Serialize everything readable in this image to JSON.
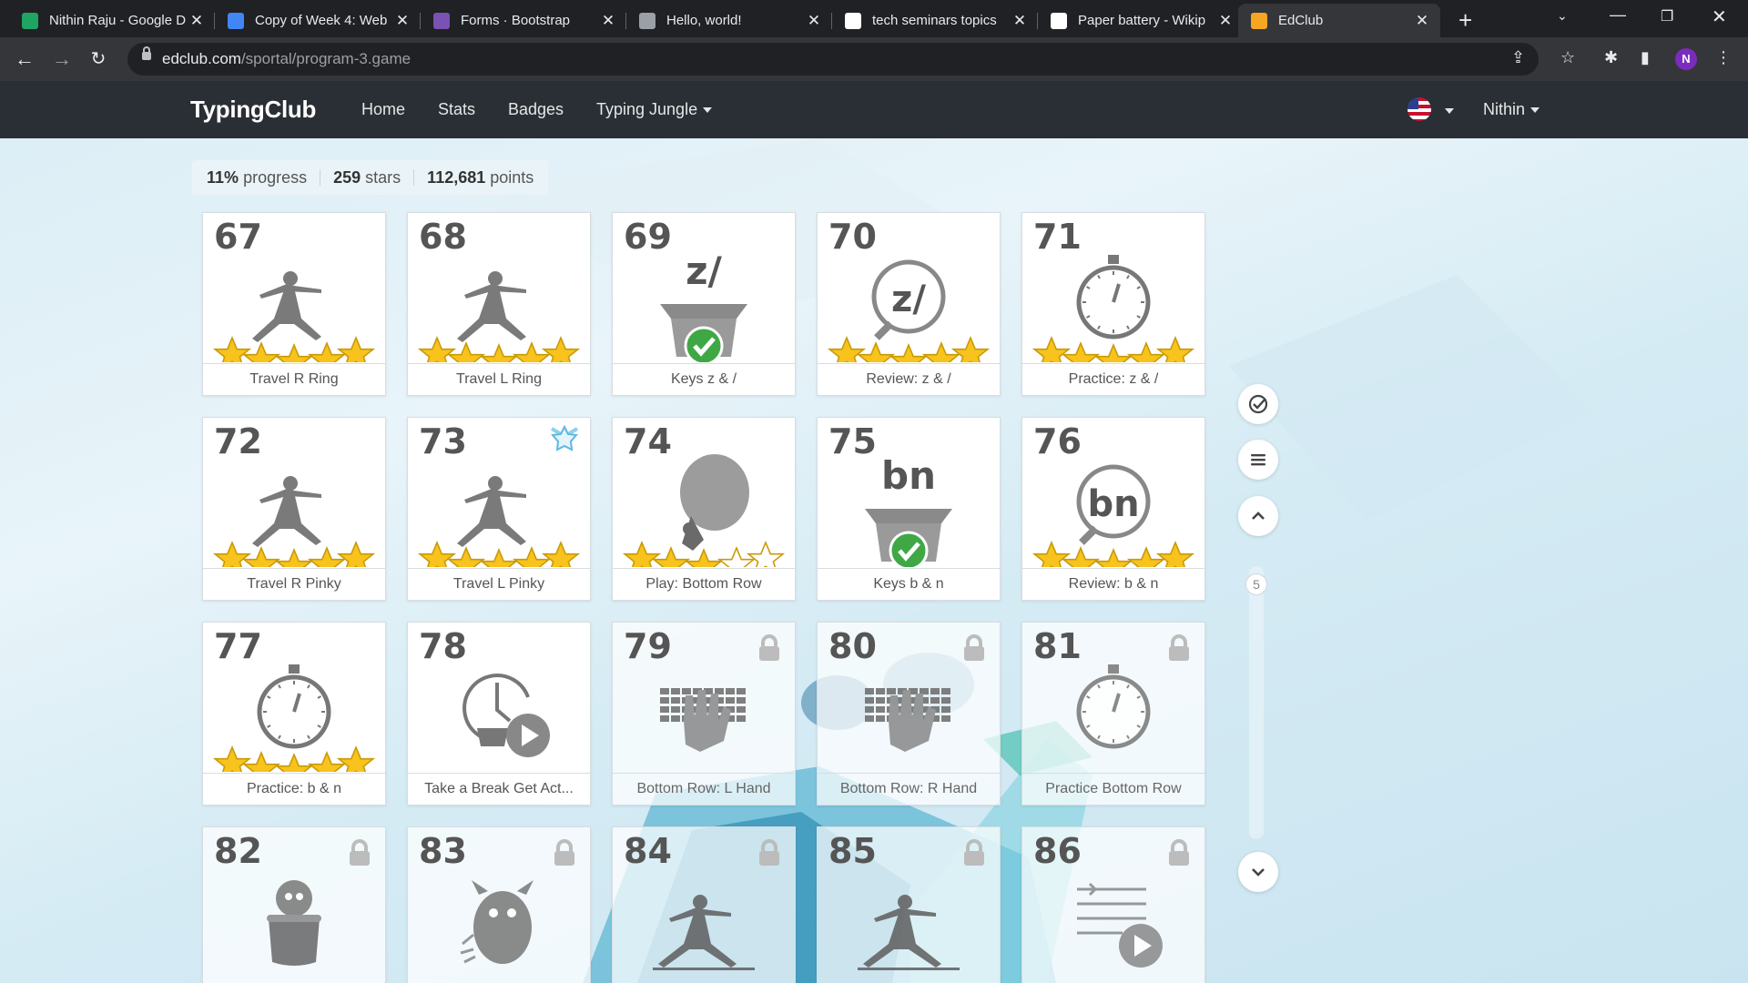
{
  "browser": {
    "tabs": [
      {
        "title": "Nithin Raju - Google D",
        "icon": "google-drive-icon",
        "color": "#1fa463"
      },
      {
        "title": "Copy of Week 4: Web",
        "icon": "google-docs-icon",
        "color": "#4285f4"
      },
      {
        "title": "Forms · Bootstrap",
        "icon": "bootstrap-icon",
        "color": "#7952b3"
      },
      {
        "title": "Hello, world!",
        "icon": "globe-icon",
        "color": "#9aa0a6"
      },
      {
        "title": "tech seminars topics",
        "icon": "google-icon",
        "color": "#ffffff"
      },
      {
        "title": "Paper battery - Wikip",
        "icon": "wikipedia-icon",
        "color": "#ffffff"
      },
      {
        "title": "EdClub",
        "icon": "edclub-icon",
        "color": "#f5a623"
      }
    ],
    "url_host": "edclub.com",
    "url_path": "/sportal/program-3.game",
    "profile_initial": "N"
  },
  "site": {
    "brand": "TypingClub",
    "nav": [
      "Home",
      "Stats",
      "Badges",
      "Typing Jungle"
    ],
    "user": "Nithin"
  },
  "stats": {
    "progress_value": "11%",
    "progress_label": "progress",
    "stars_value": "259",
    "stars_label": "stars",
    "points_value": "112,681",
    "points_label": "points"
  },
  "lessons": [
    {
      "num": "67",
      "label": "Travel R Ring",
      "art": "yoga",
      "stars": 5,
      "locked": false
    },
    {
      "num": "68",
      "label": "Travel L Ring",
      "art": "yoga",
      "stars": 5,
      "locked": false
    },
    {
      "num": "69",
      "label": "Keys z & /",
      "art": "keys",
      "keys": "z/",
      "done": true,
      "locked": false
    },
    {
      "num": "70",
      "label": "Review: z & /",
      "art": "review",
      "keys": "z/",
      "stars": 5,
      "locked": false
    },
    {
      "num": "71",
      "label": "Practice: z & /",
      "art": "stopwatch",
      "stars": 5,
      "locked": false
    },
    {
      "num": "72",
      "label": "Travel R Pinky",
      "art": "yoga",
      "stars": 5,
      "locked": false
    },
    {
      "num": "73",
      "label": "Travel L Pinky",
      "art": "yoga",
      "stars": 5,
      "locked": false,
      "badge": true
    },
    {
      "num": "74",
      "label": "Play: Bottom Row",
      "art": "balloon",
      "stars": 3,
      "locked": false
    },
    {
      "num": "75",
      "label": "Keys b & n",
      "art": "keys",
      "keys": "bn",
      "done": true,
      "locked": false
    },
    {
      "num": "76",
      "label": "Review: b & n",
      "art": "review",
      "keys": "bn",
      "stars": 5,
      "locked": false
    },
    {
      "num": "77",
      "label": "Practice: b & n",
      "art": "stopwatch",
      "stars": 5,
      "locked": false
    },
    {
      "num": "78",
      "label": "Take a Break Get Act...",
      "art": "break",
      "locked": false
    },
    {
      "num": "79",
      "label": "Bottom Row: L Hand",
      "art": "hand",
      "locked": true
    },
    {
      "num": "80",
      "label": "Bottom Row: R Hand",
      "art": "hand",
      "locked": true
    },
    {
      "num": "81",
      "label": "Practice Bottom Row",
      "art": "stopwatch",
      "locked": true
    },
    {
      "num": "82",
      "label": "",
      "art": "pot",
      "locked": true
    },
    {
      "num": "83",
      "label": "",
      "art": "monster",
      "locked": true
    },
    {
      "num": "84",
      "label": "",
      "art": "yoga-low",
      "locked": true
    },
    {
      "num": "85",
      "label": "",
      "art": "yoga-low",
      "locked": true
    },
    {
      "num": "86",
      "label": "",
      "art": "tab-video",
      "locked": true
    }
  ],
  "sidebar": {
    "page_number": "5",
    "buttons": [
      "check-circle-icon",
      "menu-icon",
      "chevron-up-icon",
      "chevron-down-icon"
    ]
  },
  "colors": {
    "star": "#f7c31c",
    "check": "#4caf50",
    "nav_bg": "#2a2f36"
  }
}
